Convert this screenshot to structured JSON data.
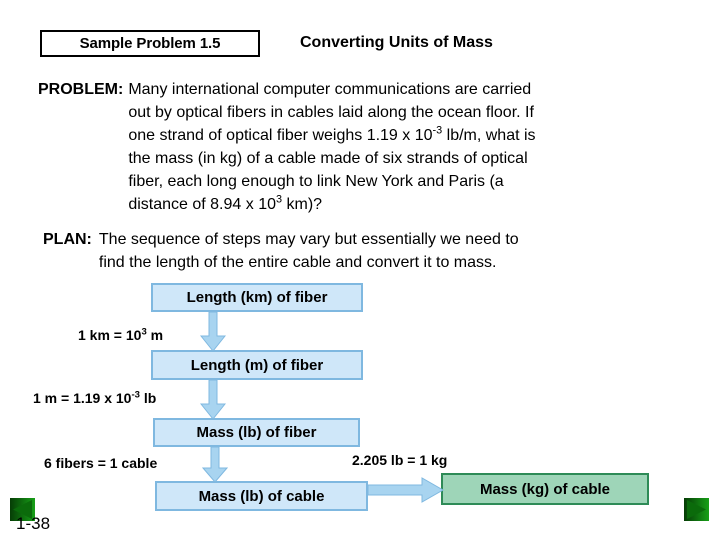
{
  "header": {
    "badge": "Sample Problem 1.5",
    "subtitle": "Converting Units of Mass"
  },
  "problem": {
    "label": "PROBLEM:",
    "lines": [
      "Many international computer communications are carried",
      "out by optical fibers in cables laid along the ocean floor. If",
      "one strand of optical fiber weighs 1.19 x 10-3 lb/m, what is",
      "the mass (in kg) of a cable made of six strands of optical",
      "fiber, each long enough to link New York and Paris (a",
      "distance of 8.94 x 103 km)?"
    ],
    "line1": "Many international computer communications are carried",
    "line2": "out by optical fibers in cables laid along the ocean floor. If",
    "line3_a": "one strand of optical fiber weighs 1.19 x 10",
    "line3_sup": "-3",
    "line3_b": " lb/m, what is",
    "line4": "the mass (in kg) of a cable made of six strands of optical",
    "line5": "fiber, each long enough to link New York and Paris (a",
    "line6_a": "distance of 8.94 x 10",
    "line6_sup": "3",
    "line6_b": " km)?"
  },
  "plan": {
    "label": "PLAN:",
    "line1": "The sequence of steps may vary but essentially we need to",
    "line2": "find the length of the entire cable and convert it to mass."
  },
  "flow": {
    "boxes": [
      {
        "id": "length-km-of-fiber",
        "label": "Length (km) of fiber",
        "color": "#cfe7f9"
      },
      {
        "id": "length-m-of-fiber",
        "label": "Length (m) of fiber",
        "color": "#cfe7f9"
      },
      {
        "id": "mass-lb-of-fiber",
        "label": "Mass (lb) of fiber",
        "color": "#cfe7f9"
      },
      {
        "id": "mass-lb-of-cable",
        "label": "Mass (lb) of cable",
        "color": "#cfe7f9"
      },
      {
        "id": "mass-kg-of-cable",
        "label": "Mass (kg) of cable",
        "color": "#9ed5b8"
      }
    ],
    "conversions": {
      "c1_a": "1 km = 10",
      "c1_sup": "3",
      "c1_b": " m",
      "c2_a": "1 m = 1.19 x 10",
      "c2_sup": "-3",
      "c2_b": " lb",
      "c3": "6 fibers = 1 cable",
      "c4": "2.205 lb = 1 kg"
    }
  },
  "footer": {
    "page_number": "1-38"
  },
  "colors": {
    "box_blue_fill": "#cfe7f9",
    "box_blue_border": "#7fb8e0",
    "box_green_fill": "#9ed5b8",
    "box_green_border": "#2e8b57",
    "arrow_fill": "#a8d4f0",
    "arrow_border": "#7fb8e0",
    "nav_green": "#0a7a0a"
  }
}
